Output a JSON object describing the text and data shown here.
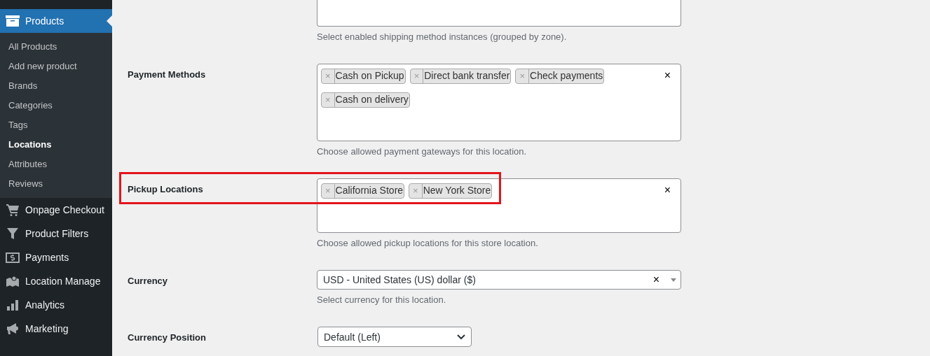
{
  "sidebar": {
    "current": {
      "label": "Products",
      "selected": true
    },
    "submenu": [
      {
        "label": "All Products",
        "selected": false
      },
      {
        "label": "Add new product",
        "selected": false
      },
      {
        "label": "Brands",
        "selected": false
      },
      {
        "label": "Categories",
        "selected": false
      },
      {
        "label": "Tags",
        "selected": false
      },
      {
        "label": "Locations",
        "selected": true
      },
      {
        "label": "Attributes",
        "selected": false
      },
      {
        "label": "Reviews",
        "selected": false
      }
    ],
    "items": [
      {
        "label": "Onpage Checkout",
        "selected": false
      },
      {
        "label": "Product Filters",
        "selected": false
      },
      {
        "label": "Payments",
        "selected": false
      },
      {
        "label": "Location Manage",
        "selected": false
      },
      {
        "label": "Analytics",
        "selected": false
      },
      {
        "label": "Marketing",
        "selected": false
      }
    ]
  },
  "form": {
    "rows": [
      {
        "kind": "multiselect",
        "highlighted": false,
        "tags": [],
        "description": "Select enabled shipping method instances (grouped by zone)."
      },
      {
        "kind": "multiselect",
        "label": "Payment Methods",
        "highlighted": false,
        "clear": "×",
        "tags": [
          {
            "label": "Cash on Pickup",
            "remove": "×"
          },
          {
            "label": "Direct bank transfer",
            "remove": "×"
          },
          {
            "label": "Check payments",
            "remove": "×"
          },
          {
            "label": "Cash on delivery",
            "remove": "×"
          }
        ],
        "description": "Choose allowed payment gateways for this location."
      },
      {
        "kind": "multiselect",
        "label": "Pickup Locations",
        "highlighted": true,
        "clear": "×",
        "tags": [
          {
            "label": "California Store",
            "remove": "×"
          },
          {
            "label": "New York Store",
            "remove": "×"
          }
        ],
        "description": "Choose allowed pickup locations for this store location."
      },
      {
        "kind": "combobox",
        "label": "Currency",
        "highlighted": false,
        "clear": "×",
        "value": "USD - United States (US) dollar ($)",
        "description": "Select currency for this location."
      },
      {
        "kind": "dropdown",
        "label": "Currency Position",
        "highlighted": false,
        "value": "Default (Left)"
      }
    ]
  }
}
